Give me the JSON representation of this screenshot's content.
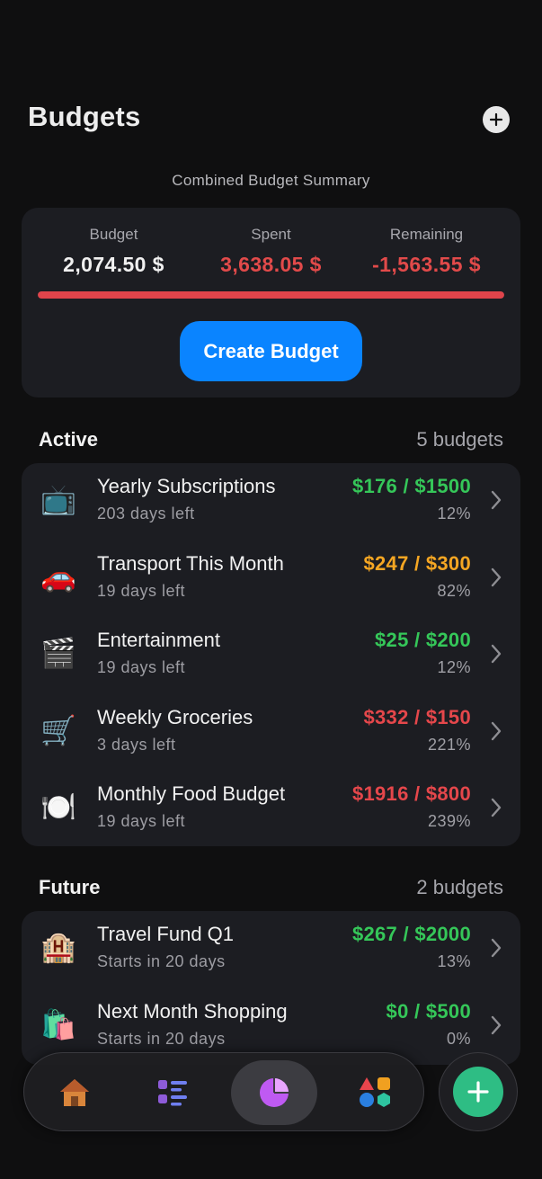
{
  "header": {
    "title": "Budgets"
  },
  "summary": {
    "title": "Combined Budget Summary",
    "budget_label": "Budget",
    "budget_value": "2,074.50 $",
    "spent_label": "Spent",
    "spent_value": "3,638.05 $",
    "remaining_label": "Remaining",
    "remaining_value": "-1,563.55 $",
    "progress_fraction": 1.0,
    "create_button": "Create Budget"
  },
  "active": {
    "label": "Active",
    "count": "5 budgets",
    "items": [
      {
        "emoji": "📺",
        "title": "Yearly Subscriptions",
        "sub": "203 days left",
        "amount": "$176 / $1500",
        "pct": "12%",
        "status": "green"
      },
      {
        "emoji": "🚗",
        "title": "Transport This Month",
        "sub": "19 days left",
        "amount": "$247 / $300",
        "pct": "82%",
        "status": "orange"
      },
      {
        "emoji": "🎬",
        "title": "Entertainment",
        "sub": "19 days left",
        "amount": "$25 / $200",
        "pct": "12%",
        "status": "green"
      },
      {
        "emoji": "🛒",
        "title": "Weekly Groceries",
        "sub": "3 days left",
        "amount": "$332 / $150",
        "pct": "221%",
        "status": "red"
      },
      {
        "emoji": "🍽️",
        "title": "Monthly Food Budget",
        "sub": "19 days left",
        "amount": "$1916 / $800",
        "pct": "239%",
        "status": "red"
      }
    ]
  },
  "future": {
    "label": "Future",
    "count": "2 budgets",
    "items": [
      {
        "emoji": "🏨",
        "title": "Travel Fund Q1",
        "sub": "Starts in 20 days",
        "amount": "$267 / $2000",
        "pct": "13%",
        "status": "green"
      },
      {
        "emoji": "🛍️",
        "title": "Next Month Shopping",
        "sub": "Starts in 20 days",
        "amount": "$0 / $500",
        "pct": "0%",
        "status": "green"
      }
    ]
  },
  "tabbar": {
    "tabs": [
      {
        "icon": "home-icon",
        "active": false
      },
      {
        "icon": "list-icon",
        "active": false
      },
      {
        "icon": "pie-chart-icon",
        "active": true
      },
      {
        "icon": "shapes-icon",
        "active": false
      }
    ],
    "fab_icon": "plus-icon"
  },
  "colors": {
    "accent": "#0a84ff",
    "green": "#35c759",
    "orange": "#f5a623",
    "red": "#e5474b",
    "fab": "#2ebd84",
    "pie": "#bf5af2"
  }
}
